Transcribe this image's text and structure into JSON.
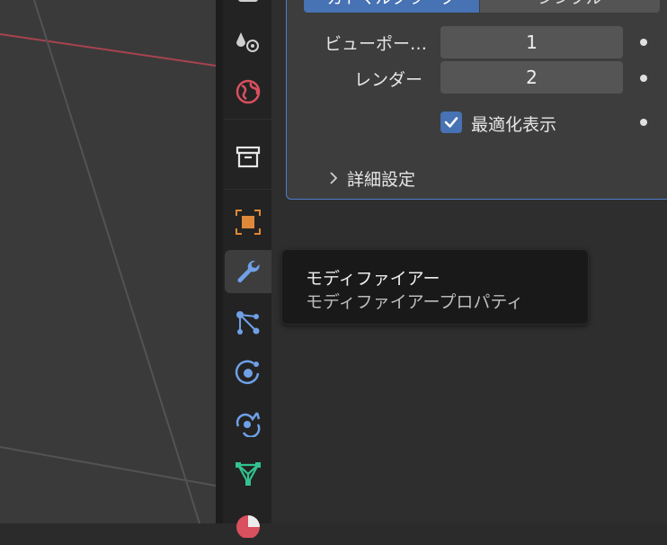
{
  "viewport": {
    "name": "3d-viewport"
  },
  "tabs": [
    {
      "id": "scene",
      "icon": "scene-icon"
    },
    {
      "id": "world",
      "icon": "world-icon"
    },
    {
      "id": "collection",
      "icon": "collection-icon"
    },
    {
      "id": "object",
      "icon": "object-icon"
    },
    {
      "id": "modifiers",
      "icon": "wrench-icon",
      "active": true
    },
    {
      "id": "particles",
      "icon": "particles-icon"
    },
    {
      "id": "physics",
      "icon": "physics-icon"
    },
    {
      "id": "constraints",
      "icon": "constraints-icon"
    },
    {
      "id": "data",
      "icon": "mesh-data-icon"
    },
    {
      "id": "material",
      "icon": "material-icon"
    }
  ],
  "panel": {
    "segment_left": "カトマルクラーク",
    "segment_right": "シンプル",
    "viewport_label": "ビューポー…",
    "viewport_value": "1",
    "render_label": "レンダー",
    "render_value": "2",
    "optimal_display_label": "最適化表示",
    "optimal_display_checked": true,
    "advanced_label": "詳細設定"
  },
  "tooltip": {
    "title": "モディファイアー",
    "description": "モディファイアープロパティ"
  },
  "colors": {
    "accent": "#4772b3",
    "panel_border": "#4e7dc9",
    "active_tab_icon": "#6fa0e8",
    "object_icon": "#e0883a",
    "mesh_icon": "#33c290"
  }
}
